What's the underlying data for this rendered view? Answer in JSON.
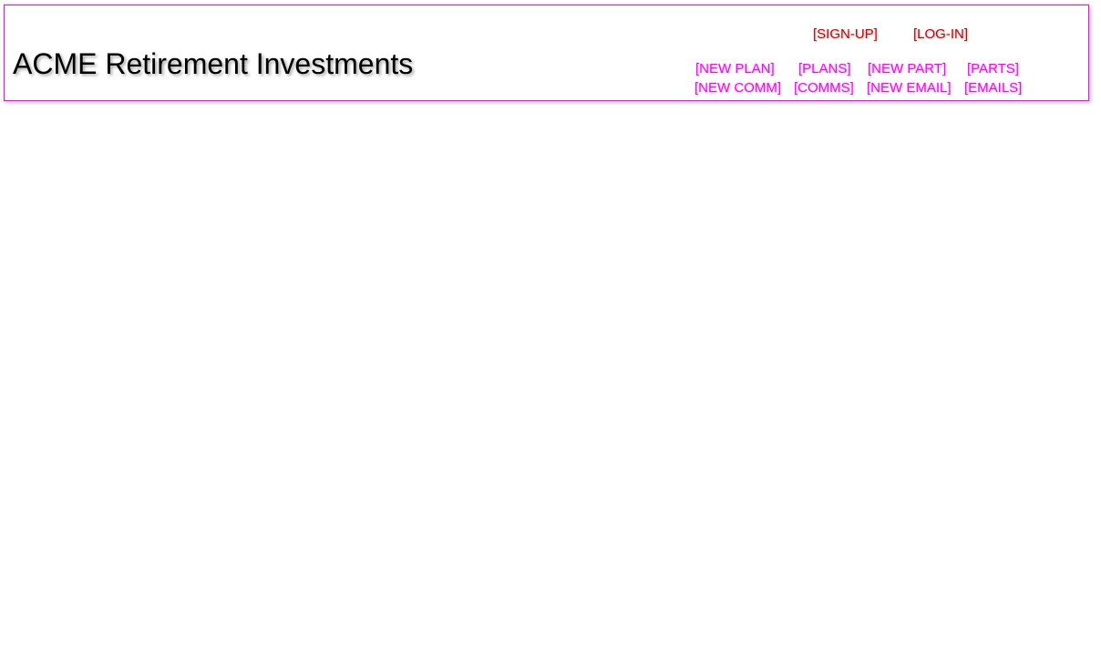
{
  "header": {
    "title": "ACME Retirement Investments",
    "auth": {
      "signup": "[SIGN-UP]",
      "login": "[LOG-IN]"
    },
    "nav": {
      "new_plan": "[NEW PLAN]",
      "plans": "[PLANS]",
      "new_part": "[NEW PART]",
      "parts": "[PARTS]",
      "new_comm": "[NEW COMM]",
      "comms": "[COMMS]",
      "new_email": "[NEW EMAIL]",
      "emails": "[EMAILS]"
    }
  },
  "colors": {
    "border": "#ff00ff",
    "auth_link": "#cc0000",
    "nav_link": "#ff00ff",
    "title": "#000000"
  }
}
